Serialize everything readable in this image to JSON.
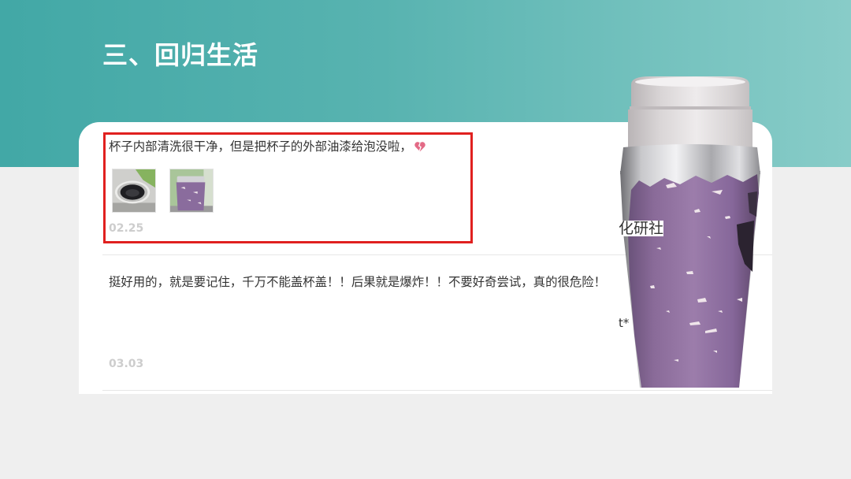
{
  "slide": {
    "title": "三、回归生活"
  },
  "reviews": [
    {
      "text": "杯子内部清洗很干净，但是把杯子的外部油漆给泡没啦，",
      "emoji_icon": "broken-heart-icon",
      "thumbnails": [
        {
          "icon": "cup-interior-icon"
        },
        {
          "icon": "purple-cup-icon"
        }
      ],
      "date": "02.25",
      "highlighted": true
    },
    {
      "text": "挺好用的，就是要记住，千万不能盖杯盖！！后果就是爆炸！！不要好奇尝试，真的很危险！",
      "date": "03.03",
      "highlighted": false
    }
  ],
  "side_labels": {
    "label_1": "化研社",
    "label_2": "t*"
  },
  "product_image": {
    "icon": "thermos-cup-icon"
  },
  "colors": {
    "header_gradient_start": "#42a8a6",
    "header_gradient_end": "#88ccc8",
    "highlight_border": "#e0201f",
    "body_text": "#333333",
    "date_text": "#cdcdcd",
    "cup_purple": "#8c6c9c"
  }
}
